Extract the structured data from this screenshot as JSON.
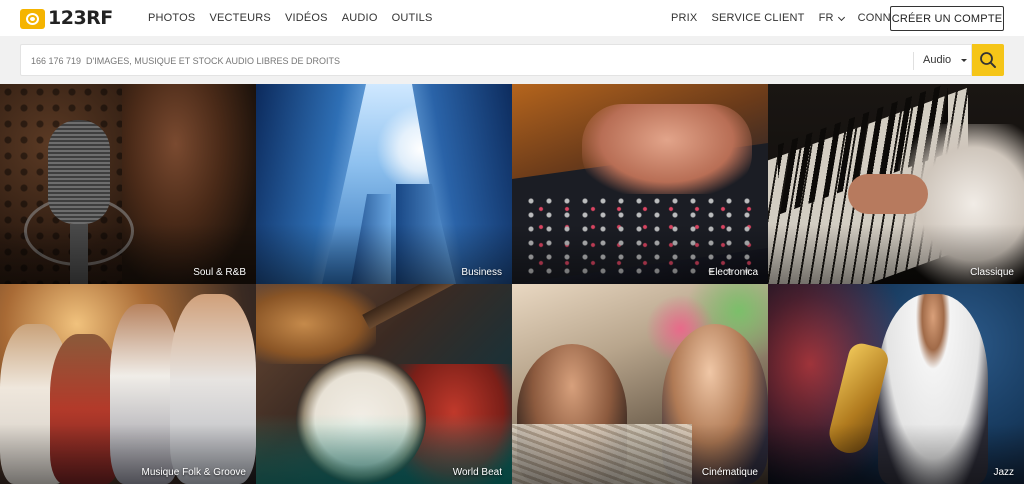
{
  "header": {
    "logo_text": "123RF",
    "nav_left": [
      "PHOTOS",
      "VECTEURS",
      "VIDÉOS",
      "AUDIO",
      "OUTILS"
    ],
    "nav_right": {
      "pricing": "PRIX",
      "support": "SERVICE CLIENT",
      "language": "FR",
      "login": "CONNEXION"
    },
    "create_account": "CRÉER UN COMPTE"
  },
  "search": {
    "placeholder": "166 176 719  D'IMAGES, MUSIQUE ET STOCK AUDIO LIBRES DE DROITS",
    "media_type": "Audio",
    "button_icon": "search-icon"
  },
  "colors": {
    "brand_yellow": "#f5c518",
    "logo_yellow": "#f5b400",
    "search_band": "#f1f1f1"
  },
  "tiles": [
    {
      "label": "Soul & R&B"
    },
    {
      "label": "Business"
    },
    {
      "label": "Electronica"
    },
    {
      "label": "Classique"
    },
    {
      "label": "Musique Folk & Groove"
    },
    {
      "label": "World Beat"
    },
    {
      "label": "Cinématique"
    },
    {
      "label": "Jazz"
    }
  ]
}
